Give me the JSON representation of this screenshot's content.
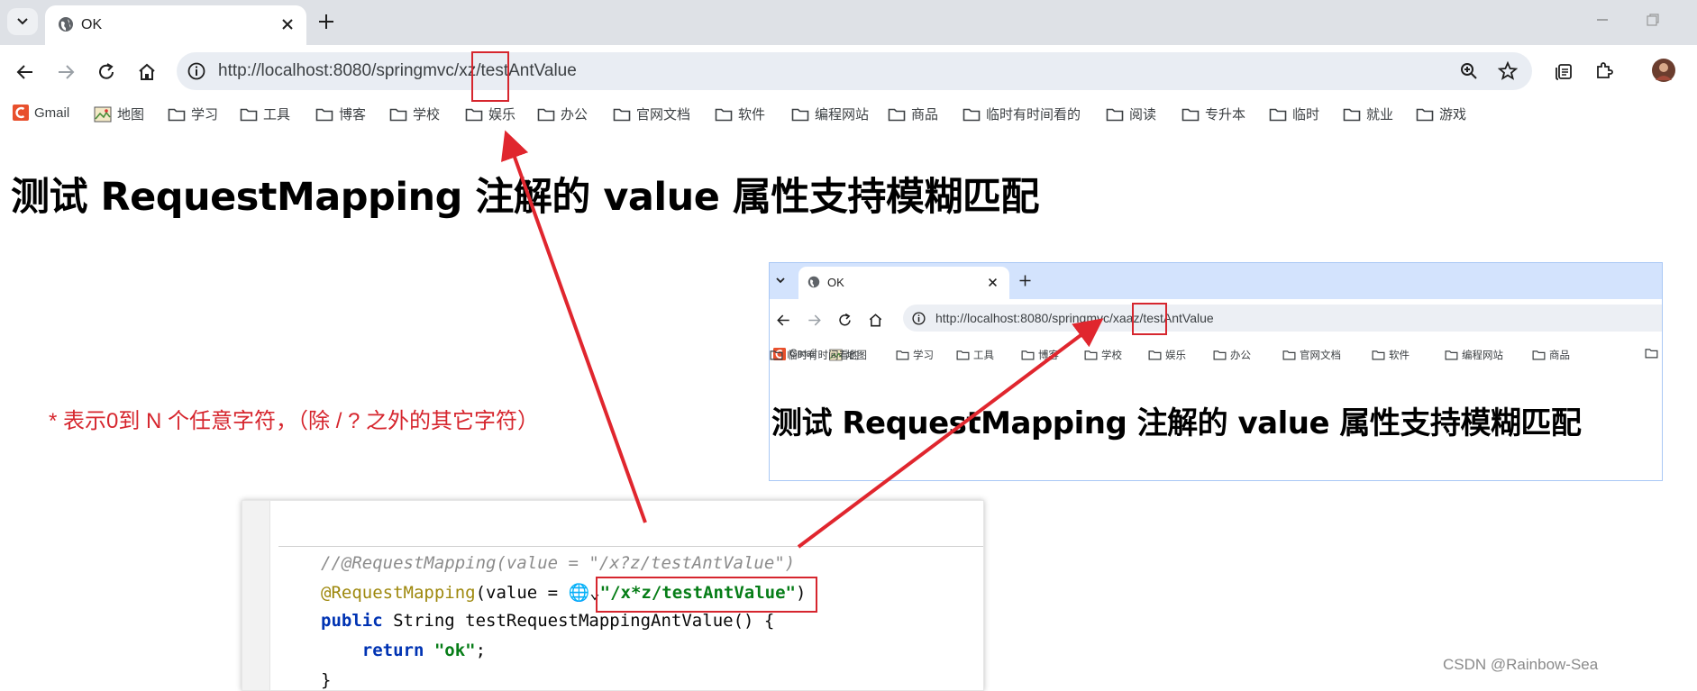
{
  "main_browser": {
    "tab_title": "OK",
    "url": "http://localhost:8080/springmvc/xz/testAntValue",
    "bookmarks": [
      {
        "label": "Gmail",
        "icon": "gmail-icon"
      },
      {
        "label": "地图",
        "icon": "map-icon"
      },
      {
        "label": "学习",
        "icon": "folder-icon"
      },
      {
        "label": "工具",
        "icon": "folder-icon"
      },
      {
        "label": "博客",
        "icon": "folder-icon"
      },
      {
        "label": "学校",
        "icon": "folder-icon"
      },
      {
        "label": "娱乐",
        "icon": "folder-icon"
      },
      {
        "label": "办公",
        "icon": "folder-icon"
      },
      {
        "label": "官网文档",
        "icon": "folder-icon"
      },
      {
        "label": "软件",
        "icon": "folder-icon"
      },
      {
        "label": "编程网站",
        "icon": "folder-icon"
      },
      {
        "label": "商品",
        "icon": "folder-icon"
      },
      {
        "label": "临时有时间看的",
        "icon": "folder-icon"
      },
      {
        "label": "阅读",
        "icon": "folder-icon"
      },
      {
        "label": "专升本",
        "icon": "folder-icon"
      },
      {
        "label": "临时",
        "icon": "folder-icon"
      },
      {
        "label": "就业",
        "icon": "folder-icon"
      },
      {
        "label": "游戏",
        "icon": "folder-icon"
      }
    ],
    "page_heading": "测试 RequestMapping 注解的 value 属性支持模糊匹配"
  },
  "inset_browser": {
    "tab_title": "OK",
    "url": "http://localhost:8080/springmvc/xaaz/testAntValue",
    "bookmarks": [
      {
        "label": "Gmail",
        "icon": "gmail-icon"
      },
      {
        "label": "地图",
        "icon": "map-icon"
      },
      {
        "label": "学习",
        "icon": "folder-icon"
      },
      {
        "label": "工具",
        "icon": "folder-icon"
      },
      {
        "label": "博客",
        "icon": "folder-icon"
      },
      {
        "label": "学校",
        "icon": "folder-icon"
      },
      {
        "label": "娱乐",
        "icon": "folder-icon"
      },
      {
        "label": "办公",
        "icon": "folder-icon"
      },
      {
        "label": "官网文档",
        "icon": "folder-icon"
      },
      {
        "label": "软件",
        "icon": "folder-icon"
      },
      {
        "label": "编程网站",
        "icon": "folder-icon"
      },
      {
        "label": "商品",
        "icon": "folder-icon"
      },
      {
        "label": "临时有时间看的",
        "icon": "folder-icon"
      }
    ],
    "page_heading": "测试 RequestMapping 注解的 value 属性支持模糊匹配"
  },
  "annotation_note": "* 表示0到 N 个任意字符，（除 / ? 之外的其它字符）",
  "code": {
    "line1": "//@RequestMapping(value = \"/x?z/testAntValue\")",
    "line2_annotation": "@RequestMapping",
    "line2_mid": "(value = ",
    "line2_string": "\"/x*z/testAntValue\"",
    "line2_end": ")",
    "line3_kw": "public",
    "line3_rest": " String testRequestMappingAntValue() {",
    "line4_kw": "return",
    "line4_string": "\"ok\"",
    "line4_end": ";",
    "line5": "}"
  },
  "watermark": "CSDN @Rainbow-Sea",
  "colors": {
    "annotation_red": "#d6262e",
    "chrome_bg": "#dee1e6",
    "inset_strip": "#d3e3fd"
  }
}
